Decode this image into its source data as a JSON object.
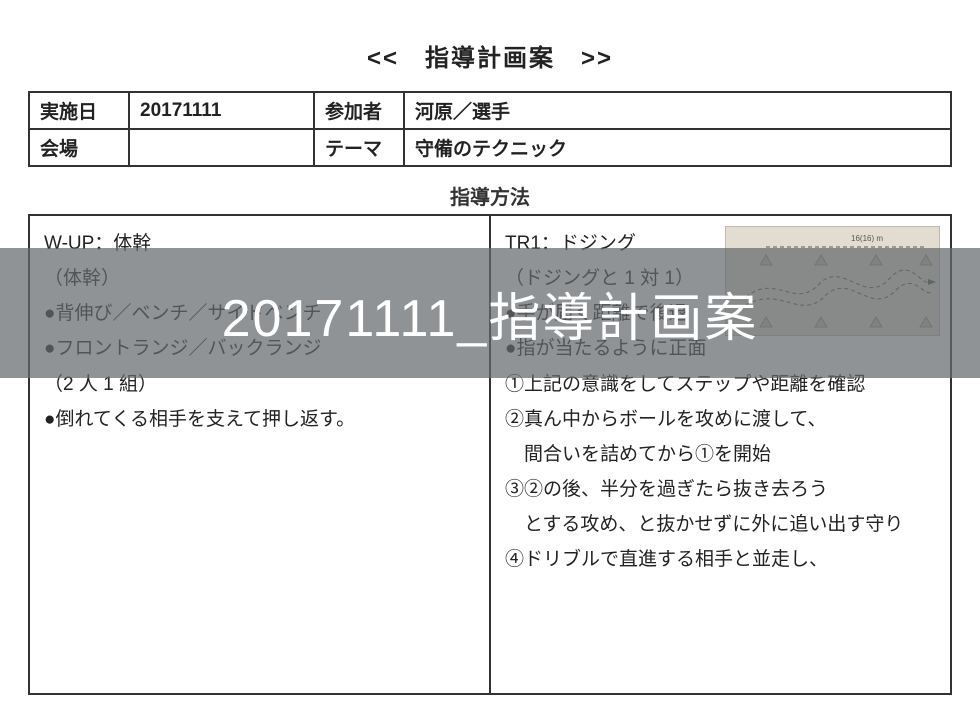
{
  "title": "<<　指導計画案　>>",
  "header": {
    "row1": {
      "label": "実施日",
      "value": "20171111",
      "label2": "参加者",
      "value2": "河原／選手"
    },
    "row2": {
      "label": "会場",
      "value": "",
      "label2": "テーマ",
      "value2": "守備のテクニック"
    }
  },
  "section_heading": "指導方法",
  "left": {
    "h1": "W-UP：体幹",
    "h2": "（体幹）",
    "b1": "●背伸び／ベンチ／サイドベンチ",
    "b2": "●フロントランジ／バックランジ",
    "b2a": "（2 人 1 組）",
    "b3": "●倒れてくる相手を支えて押し返す。"
  },
  "right": {
    "h1": "TR1：ドジング",
    "h2": "（ドジングと 1 対 1）",
    "b1": "●手が届く距離で後退",
    "b2": "●指が当たるように正面",
    "s1": "①上記の意識をしてステップや距離を確認",
    "s2": "②真ん中からボールを攻めに渡して、",
    "s2a": "　間合いを詰めてから①を開始",
    "s3": "③②の後、半分を過ぎたら抜き去ろう",
    "s3a": "　とする攻め、と抜かせずに外に追い出す守り",
    "s4": "④ドリブルで直進する相手と並走し、"
  },
  "diagram_label": "16(16) m",
  "overlay": "20171111_指導計画案"
}
